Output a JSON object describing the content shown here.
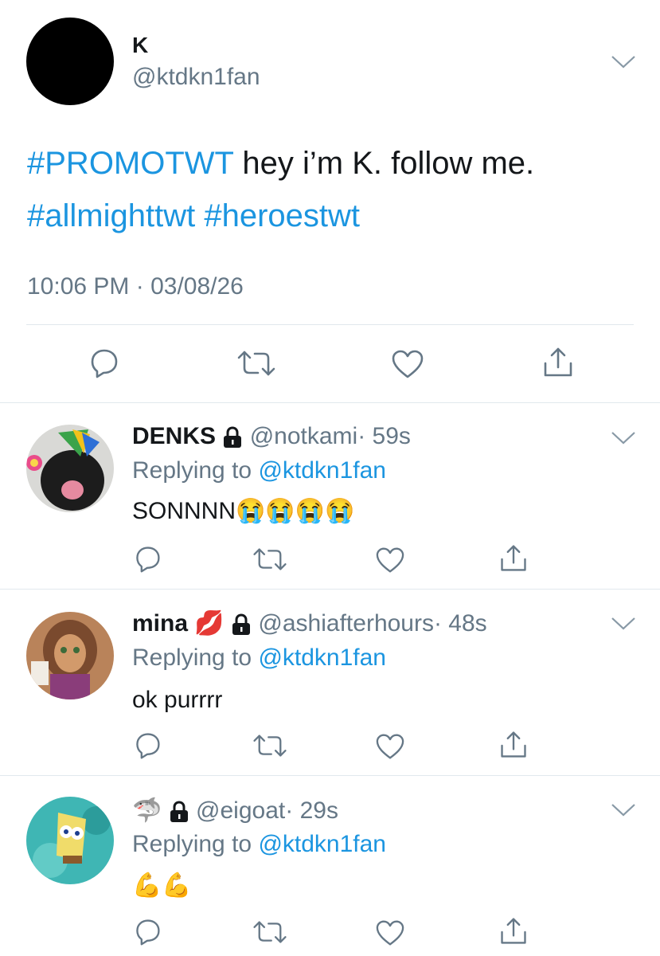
{
  "colors": {
    "link": "#1b95e0",
    "muted": "#657786",
    "text": "#14171a",
    "divider": "#e1e8ed"
  },
  "main_tweet": {
    "name": "K",
    "handle": "@ktdkn1fan",
    "text_hashtag1": "#PROMOTWT",
    "text_body": " hey i’m K. follow me.",
    "text_hashtag2": "#allmighttwt",
    "text_hashtag3": "#heroestwt",
    "timestamp": "10:06 PM · 03/08/26"
  },
  "replies": [
    {
      "name": "DENKS",
      "handle": "@notkami",
      "time": "· 59s",
      "replying_label": "Replying to ",
      "replying_handle": "@ktdkn1fan",
      "text": "SONNNN😭😭😭😭"
    },
    {
      "name": "mina",
      "name_emoji": "💋",
      "handle": "@ashiafterhours",
      "time": "· 48s",
      "replying_label": "Replying to ",
      "replying_handle": "@ktdkn1fan",
      "text": "ok purrrr"
    },
    {
      "name_emoji": "🦈",
      "handle": "@eigoat",
      "time": "· 29s",
      "replying_label": "Replying to ",
      "replying_handle": "@ktdkn1fan",
      "text": "💪💪"
    }
  ],
  "icons": [
    "reply-icon",
    "retweet-icon",
    "like-icon",
    "share-icon",
    "chevron-down-icon",
    "lock-icon"
  ]
}
